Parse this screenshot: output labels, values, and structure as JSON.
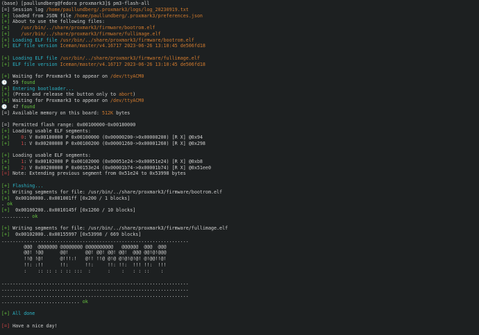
{
  "colors": {
    "background": "#1d2021",
    "default": "#d0d0d0",
    "cyan": "#2cb5c8",
    "orange": "#d27b2e",
    "green": "#66c240",
    "red": "#d04545"
  },
  "terminal": {
    "lines": [
      [
        {
          "t": "(base) [paullundberg@fedora proxmark3]$ pm3-flash-all",
          "c": "default"
        }
      ],
      [
        {
          "t": "[=] ",
          "c": "default"
        },
        {
          "t": "Session log ",
          "c": "default"
        },
        {
          "t": "/home/paullundberg/.proxmark3/logs/log_20230919.txt",
          "c": "orange"
        }
      ],
      [
        {
          "t": "[+] ",
          "c": "green"
        },
        {
          "t": "loaded from JSON file ",
          "c": "default"
        },
        {
          "t": "/home/paullundberg/.proxmark3/preferences.json",
          "c": "orange"
        }
      ],
      [
        {
          "t": "[+] ",
          "c": "green"
        },
        {
          "t": "About to use the following files:",
          "c": "default"
        }
      ],
      [
        {
          "t": "[+] ",
          "c": "green"
        },
        {
          "t": "   /usr/bin/../share/proxmark3/firmware/bootrom.elf",
          "c": "orange"
        }
      ],
      [
        {
          "t": "[+] ",
          "c": "green"
        },
        {
          "t": "   /usr/bin/../share/proxmark3/firmware/fullimage.elf",
          "c": "orange"
        }
      ],
      [
        {
          "t": "[+] ",
          "c": "green"
        },
        {
          "t": "Loading ELF file ",
          "c": "cyan"
        },
        {
          "t": "/usr/bin/../share/proxmark3/firmware/bootrom.elf",
          "c": "orange"
        }
      ],
      [
        {
          "t": "[+] ",
          "c": "green"
        },
        {
          "t": "ELF file version ",
          "c": "cyan"
        },
        {
          "t": "Iceman/master/v4.16717 2023-06-26 13:10:45 de506fd18",
          "c": "orange"
        }
      ],
      [
        {
          "t": "",
          "c": "default"
        }
      ],
      [
        {
          "t": "[+] ",
          "c": "green"
        },
        {
          "t": "Loading ELF file ",
          "c": "cyan"
        },
        {
          "t": "/usr/bin/../share/proxmark3/firmware/fullimage.elf",
          "c": "orange"
        }
      ],
      [
        {
          "t": "[+] ",
          "c": "green"
        },
        {
          "t": "ELF file version ",
          "c": "cyan"
        },
        {
          "t": "Iceman/master/v4.16717 2023-06-26 13:10:45 de506fd18",
          "c": "orange"
        }
      ],
      [
        {
          "t": "",
          "c": "default"
        }
      ],
      [
        {
          "t": "[+] ",
          "c": "green"
        },
        {
          "t": "Waiting for Proxmark3 to appear on ",
          "c": "default"
        },
        {
          "t": "/dev/ttyACM0",
          "c": "orange"
        }
      ],
      [
        {
          "t": "🕑  59 ",
          "c": "default"
        },
        {
          "t": "found",
          "c": "green"
        }
      ],
      [
        {
          "t": "[+] ",
          "c": "green"
        },
        {
          "t": "Entering bootloader...",
          "c": "cyan"
        }
      ],
      [
        {
          "t": "[+] ",
          "c": "green"
        },
        {
          "t": "(Press and release the button only to ",
          "c": "default"
        },
        {
          "t": "abort",
          "c": "orange"
        },
        {
          "t": ")",
          "c": "default"
        }
      ],
      [
        {
          "t": "[+] ",
          "c": "green"
        },
        {
          "t": "Waiting for Proxmark3 to appear on ",
          "c": "default"
        },
        {
          "t": "/dev/ttyACM0",
          "c": "orange"
        }
      ],
      [
        {
          "t": "🕑  47 ",
          "c": "default"
        },
        {
          "t": "found",
          "c": "green"
        }
      ],
      [
        {
          "t": "[=] ",
          "c": "default"
        },
        {
          "t": "Available memory on this board: ",
          "c": "default"
        },
        {
          "t": "512K",
          "c": "orange"
        },
        {
          "t": " bytes",
          "c": "default"
        }
      ],
      [
        {
          "t": "",
          "c": "default"
        }
      ],
      [
        {
          "t": "[=] ",
          "c": "default"
        },
        {
          "t": "Permitted flash range: 0x00100000-0x00180000",
          "c": "default"
        }
      ],
      [
        {
          "t": "[+] ",
          "c": "green"
        },
        {
          "t": "Loading usable ELF segments:",
          "c": "default"
        }
      ],
      [
        {
          "t": "[+] ",
          "c": "green"
        },
        {
          "t": "   0",
          "c": "red"
        },
        {
          "t": ": V 0x00100000 P 0x00100000 (0x00000200->0x00000200) [R X] @0x94",
          "c": "default"
        }
      ],
      [
        {
          "t": "[+] ",
          "c": "green"
        },
        {
          "t": "   1",
          "c": "red"
        },
        {
          "t": ": V 0x00200000 P 0x00100200 (0x00001260->0x00001260) [R X] @0x298",
          "c": "default"
        }
      ],
      [
        {
          "t": "",
          "c": "default"
        }
      ],
      [
        {
          "t": "[+] ",
          "c": "green"
        },
        {
          "t": "Loading usable ELF segments:",
          "c": "default"
        }
      ],
      [
        {
          "t": "[+] ",
          "c": "green"
        },
        {
          "t": "   1",
          "c": "red"
        },
        {
          "t": ": V 0x00102000 P 0x00102000 (0x00051e24->0x00051e24) [R X] @0xb8",
          "c": "default"
        }
      ],
      [
        {
          "t": "[+] ",
          "c": "green"
        },
        {
          "t": "   2",
          "c": "red"
        },
        {
          "t": ": V 0x00200000 P 0x00153e24 (0x00001b74->0x00001b74) [R X] @0x51ee0",
          "c": "default"
        }
      ],
      [
        {
          "t": "[=] ",
          "c": "red"
        },
        {
          "t": "Note: Extending previous segment from 0x51e24 to 0x53998 bytes",
          "c": "default"
        }
      ],
      [
        {
          "t": "",
          "c": "default"
        }
      ],
      [
        {
          "t": "[+] ",
          "c": "green"
        },
        {
          "t": "Flashing...",
          "c": "cyan"
        }
      ],
      [
        {
          "t": "[+] ",
          "c": "green"
        },
        {
          "t": "Writing segments for file: /usr/bin/../share/proxmark3/firmware/bootrom.elf",
          "c": "default"
        }
      ],
      [
        {
          "t": "[+] ",
          "c": "green"
        },
        {
          "t": " 0x00100000..0x001001ff [0x200 / 1 blocks]",
          "c": "default"
        }
      ],
      [
        {
          "t": ". ",
          "c": "default"
        },
        {
          "t": "ok",
          "c": "green"
        }
      ],
      [
        {
          "t": "[+] ",
          "c": "green"
        },
        {
          "t": " 0x00100200..0x0010145f [0x1260 / 10 blocks]",
          "c": "default"
        }
      ],
      [
        {
          "t": ".......... ",
          "c": "default"
        },
        {
          "t": "ok",
          "c": "green"
        }
      ],
      [
        {
          "t": "",
          "c": "default"
        }
      ],
      [
        {
          "t": "[+] ",
          "c": "green"
        },
        {
          "t": "Writing segments for file: /usr/bin/../share/proxmark3/firmware/fullimage.elf",
          "c": "default"
        }
      ],
      [
        {
          "t": "[+] ",
          "c": "green"
        },
        {
          "t": " 0x00102000..0x00155997 [0x53998 / 669 blocks]",
          "c": "default"
        }
      ],
      [
        {
          "t": "...................................................................",
          "c": "default"
        }
      ],
      [
        {
          "t": "        @@@  @@@@@@@ @@@@@@@@ @@@@@@@@@@   @@@@@@  @@@  @@@",
          "c": "dim"
        }
      ],
      [
        {
          "t": "        @@! !@@      @@!      @@! @@! @@! @@!  @@@ @@!@!@@@",
          "c": "dim"
        }
      ],
      [
        {
          "t": "        !!@ !@!      @!!!:!   @!! !!@ @!@ @!@!@!@! @!@@!!@!",
          "c": "dim"
        }
      ],
      [
        {
          "t": "        !!: :!!      !!:      !!:     !!: !!:  !!! !!:  !!!",
          "c": "dim"
        }
      ],
      [
        {
          "t": "        :    :: :: : : :: :::  :      :    :   : : ::    :",
          "c": "dim"
        }
      ],
      [
        {
          "t": "",
          "c": "default"
        }
      ],
      [
        {
          "t": "...................................................................",
          "c": "default"
        }
      ],
      [
        {
          "t": "...................................................................",
          "c": "default"
        }
      ],
      [
        {
          "t": "...................................................................",
          "c": "default"
        }
      ],
      [
        {
          "t": "............................ ",
          "c": "default"
        },
        {
          "t": "ok",
          "c": "green"
        }
      ],
      [
        {
          "t": "",
          "c": "default"
        }
      ],
      [
        {
          "t": "[+] ",
          "c": "green"
        },
        {
          "t": "All done",
          "c": "cyan"
        }
      ],
      [
        {
          "t": "",
          "c": "default"
        }
      ],
      [
        {
          "t": "[=] ",
          "c": "red"
        },
        {
          "t": "Have a nice day!",
          "c": "default"
        }
      ]
    ]
  }
}
